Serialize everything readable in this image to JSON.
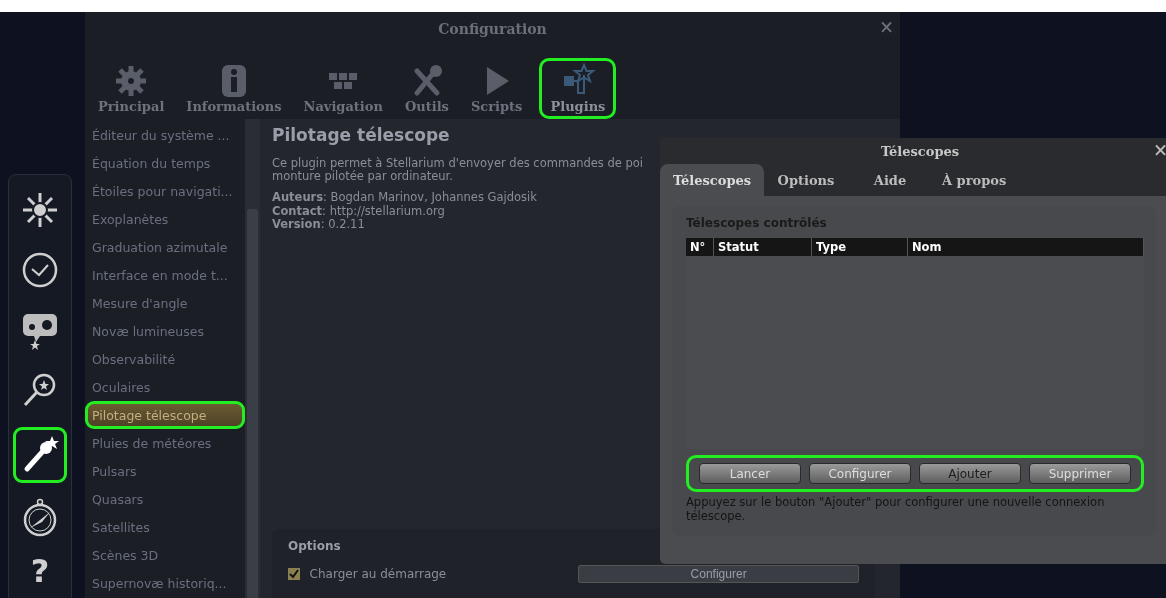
{
  "side_bar": {
    "items": [
      {
        "highlighted": false
      },
      {
        "highlighted": false
      },
      {
        "highlighted": false
      },
      {
        "highlighted": false
      },
      {
        "highlighted": true
      },
      {
        "highlighted": false
      }
    ],
    "help_glyph": "?"
  },
  "config_window": {
    "title": "Configuration",
    "close": "×",
    "tabs": [
      {
        "label": "Principal",
        "selected": false,
        "highlighted": false
      },
      {
        "label": "Informations",
        "selected": false,
        "highlighted": false
      },
      {
        "label": "Navigation",
        "selected": false,
        "highlighted": false
      },
      {
        "label": "Outils",
        "selected": false,
        "highlighted": false
      },
      {
        "label": "Scripts",
        "selected": false,
        "highlighted": false
      },
      {
        "label": "Plugins",
        "selected": true,
        "highlighted": true
      }
    ],
    "plugins": [
      {
        "label": "Éditeur du système ...",
        "selected": false,
        "highlighted": false
      },
      {
        "label": "Équation du temps",
        "selected": false,
        "highlighted": false
      },
      {
        "label": "Étoiles pour navigati...",
        "selected": false,
        "highlighted": false
      },
      {
        "label": "Exoplanètes",
        "selected": false,
        "highlighted": false
      },
      {
        "label": "Graduation azimutale",
        "selected": false,
        "highlighted": false
      },
      {
        "label": "Interface en mode t...",
        "selected": false,
        "highlighted": false
      },
      {
        "label": "Mesure d'angle",
        "selected": false,
        "highlighted": false
      },
      {
        "label": "Novæ lumineuses",
        "selected": false,
        "highlighted": false
      },
      {
        "label": "Observabilité",
        "selected": false,
        "highlighted": false
      },
      {
        "label": "Oculaires",
        "selected": false,
        "highlighted": false
      },
      {
        "label": "Pilotage télescope",
        "selected": true,
        "highlighted": true
      },
      {
        "label": "Pluies de météores",
        "selected": false,
        "highlighted": false
      },
      {
        "label": "Pulsars",
        "selected": false,
        "highlighted": false
      },
      {
        "label": "Quasars",
        "selected": false,
        "highlighted": false
      },
      {
        "label": "Satellites",
        "selected": false,
        "highlighted": false
      },
      {
        "label": "Scènes 3D",
        "selected": false,
        "highlighted": false
      },
      {
        "label": "Supernovæ historiq...",
        "selected": false,
        "highlighted": false
      }
    ],
    "plugin_title": "Pilotage télescope",
    "description_lines": [
      "Ce plugin permet à Stellarium d'envoyer des commandes de poi",
      "monture pilotée par ordinateur."
    ],
    "meta_lines": [
      "**Auteurs**: Bogdan Marinov, Johannes Gajdosik",
      "**Contact**: http://stellarium.org",
      "**Version**: 0.2.11"
    ],
    "options": {
      "title": "Options",
      "load_at_startup": {
        "label": "Charger au démarrage",
        "checked": true
      },
      "configure_button": "Configurer"
    }
  },
  "telescopes_dialog": {
    "title": "Télescopes",
    "close": "×",
    "tabs": [
      {
        "label": "Télescopes",
        "selected": true
      },
      {
        "label": "Options",
        "selected": false
      },
      {
        "label": "Aide",
        "selected": false
      },
      {
        "label": "À propos",
        "selected": false
      }
    ],
    "group_title": "Télescopes contrôlés",
    "table": {
      "columns": [
        "N°",
        "Statut",
        "Type",
        "Nom"
      ]
    },
    "buttons": [
      {
        "label": "Lancer",
        "disabled": true
      },
      {
        "label": "Configurer",
        "disabled": true
      },
      {
        "label": "Ajouter",
        "disabled": false
      },
      {
        "label": "Supprimer",
        "disabled": true
      }
    ],
    "buttons_highlighted": true,
    "hint": "Appuyez sur le bouton \"Ajouter\" pour configurer une nouvelle connexion télescope."
  }
}
